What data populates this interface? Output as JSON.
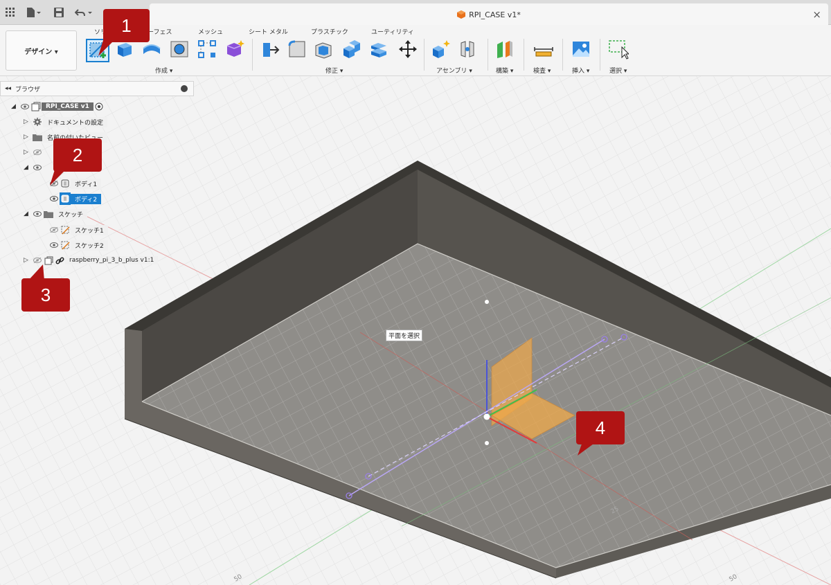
{
  "window": {
    "document_title": "RPI_CASE v1*",
    "close_glyph": "×",
    "quick_access": [
      "apps-grid-icon",
      "file-icon",
      "save-icon",
      "undo-icon"
    ]
  },
  "ribbon": {
    "workspace_label": "デザイン ▾",
    "tabs": [
      "ソリッド",
      "サーフェス",
      "メッシュ",
      "シート メタル",
      "プラスチック",
      "ユーティリティ"
    ],
    "groups": {
      "create": "作成 ▾",
      "modify": "修正 ▾",
      "assemble": "アセンブリ ▾",
      "construct": "構築 ▾",
      "inspect": "検査 ▾",
      "insert": "挿入 ▾",
      "select": "選択 ▾"
    }
  },
  "browser": {
    "title": "ブラウザ",
    "root": "RPI_CASE v1",
    "items": {
      "doc_settings": "ドキュメントの設定",
      "named_views": "名前の付いたビュー",
      "body1": "ボディ1",
      "body2": "ボディ2",
      "sketches": "スケッチ",
      "sketch1": "スケッチ1",
      "sketch2": "スケッチ2",
      "component": "raspberry_pi_3_b_plus v1:1"
    }
  },
  "viewport": {
    "tooltip": "平面を選択",
    "ruler_labels": [
      "50",
      "50",
      "25"
    ]
  },
  "callouts": [
    "1",
    "2",
    "3",
    "4"
  ],
  "colors": {
    "accent": "#1a7fcf",
    "callout": "#b01414",
    "case_dark": "#4d4a45",
    "floor": "#8f8d89"
  }
}
